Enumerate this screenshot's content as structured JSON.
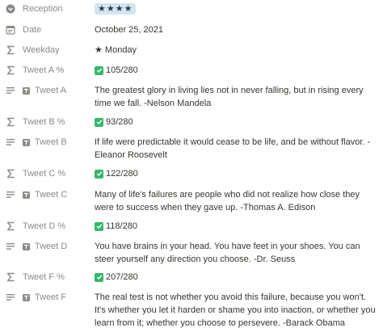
{
  "properties": [
    {
      "key": "reception",
      "name": "Reception",
      "icon": "select-icon",
      "type": "select",
      "value": "★★★★"
    },
    {
      "key": "date",
      "name": "Date",
      "icon": "calendar-icon",
      "type": "date",
      "value": "October 25, 2021"
    },
    {
      "key": "weekday",
      "name": "Weekday",
      "icon": "sigma-icon",
      "type": "formula",
      "value": "★ Monday"
    },
    {
      "key": "tweet_a_pct",
      "name": "Tweet A %",
      "icon": "sigma-icon",
      "type": "formula-check",
      "value": "105/280"
    },
    {
      "key": "tweet_a",
      "name": "Tweet A",
      "icon": "text-icon",
      "type": "text",
      "value": "The greatest glory in living lies not in never falling, but in rising every time we fall. -Nelson Mandela"
    },
    {
      "key": "tweet_b_pct",
      "name": "Tweet B %",
      "icon": "sigma-icon",
      "type": "formula-check",
      "value": "93/280"
    },
    {
      "key": "tweet_b",
      "name": "Tweet B",
      "icon": "text-icon",
      "type": "text",
      "value": "If life were predictable it would cease to be life, and be without flavor. -Eleanor Roosevelt"
    },
    {
      "key": "tweet_c_pct",
      "name": "Tweet C %",
      "icon": "sigma-icon",
      "type": "formula-check",
      "value": "122/280"
    },
    {
      "key": "tweet_c",
      "name": "Tweet C",
      "icon": "text-icon",
      "type": "text",
      "value": "Many of life's failures are people who did not realize how close they were to success when they gave up. -Thomas A. Edison"
    },
    {
      "key": "tweet_d_pct",
      "name": "Tweet D %",
      "icon": "sigma-icon",
      "type": "formula-check",
      "value": "118/280"
    },
    {
      "key": "tweet_d",
      "name": "Tweet D",
      "icon": "text-icon",
      "type": "text",
      "value": "You have brains in your head. You have feet in your shoes. You can steer yourself any direction you choose. -Dr. Seuss"
    },
    {
      "key": "tweet_f_pct",
      "name": "Tweet F %",
      "icon": "sigma-icon",
      "type": "formula-check",
      "value": "207/280"
    },
    {
      "key": "tweet_f",
      "name": "Tweet F",
      "icon": "text-icon",
      "type": "text",
      "value": "The real test is not whether you avoid this failure, because you won't. It's whether you let it harden or shame you into inaction, or whether you learn from it; whether you choose to persevere. -Barack Obama"
    }
  ],
  "colors": {
    "check": "#35b86b",
    "tag_bg": "#d3e5ef",
    "label": "#8b8a86",
    "text": "#37352f"
  }
}
